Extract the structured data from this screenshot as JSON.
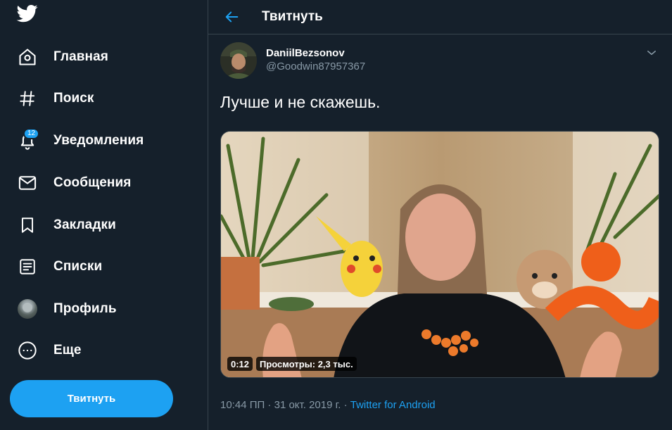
{
  "sidebar": {
    "logo": "twitter-bird-icon",
    "items": [
      {
        "label": "Главная",
        "icon": "home-icon"
      },
      {
        "label": "Поиск",
        "icon": "hashtag-icon"
      },
      {
        "label": "Уведомления",
        "icon": "bell-icon",
        "badge": "12"
      },
      {
        "label": "Сообщения",
        "icon": "envelope-icon"
      },
      {
        "label": "Закладки",
        "icon": "bookmark-icon"
      },
      {
        "label": "Списки",
        "icon": "list-icon"
      },
      {
        "label": "Профиль",
        "icon": "avatar"
      },
      {
        "label": "Еще",
        "icon": "more-icon"
      }
    ],
    "tweet_button": "Твитнуть"
  },
  "header": {
    "title": "Твитнуть",
    "back_icon": "arrow-left-icon"
  },
  "tweet": {
    "author_name": "DaniilBezsonov",
    "author_handle": "@Goodwin87957367",
    "text": "Лучше и не скажешь.",
    "video": {
      "duration": "0:12",
      "views": "Просмотры: 2,3 тыс."
    },
    "meta": {
      "timestamp": "10:44 ПП · 31 окт. 2019 г. · ",
      "source": "Twitter for Android"
    }
  },
  "colors": {
    "background": "#15202b",
    "accent": "#1da1f2",
    "secondary_text": "#8899a6",
    "border": "#38444d"
  }
}
